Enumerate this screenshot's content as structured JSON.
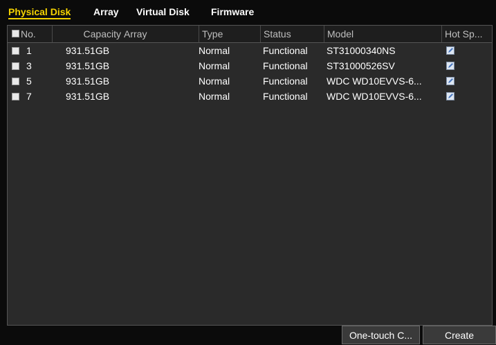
{
  "tabs": [
    {
      "label": "Physical Disk",
      "active": true
    },
    {
      "label": "Array",
      "active": false
    },
    {
      "label": "Virtual Disk",
      "active": false
    },
    {
      "label": "Firmware",
      "active": false
    }
  ],
  "table": {
    "columns": {
      "no": "No.",
      "capacity": "Capacity",
      "array": "Array",
      "type": "Type",
      "status": "Status",
      "model": "Model",
      "hot_spare": "Hot Sp..."
    },
    "rows": [
      {
        "no": "1",
        "capacity": "931.51GB",
        "array": "",
        "type": "Normal",
        "status": "Functional",
        "model": "ST31000340NS"
      },
      {
        "no": "3",
        "capacity": "931.51GB",
        "array": "",
        "type": "Normal",
        "status": "Functional",
        "model": "ST31000526SV"
      },
      {
        "no": "5",
        "capacity": "931.51GB",
        "array": "",
        "type": "Normal",
        "status": "Functional",
        "model": "WDC WD10EVVS-6..."
      },
      {
        "no": "7",
        "capacity": "931.51GB",
        "array": "",
        "type": "Normal",
        "status": "Functional",
        "model": "WDC WD10EVVS-6..."
      }
    ]
  },
  "buttons": {
    "one_touch": "One-touch C...",
    "create": "Create"
  },
  "colors": {
    "active_tab": "#f5d300",
    "panel_bg": "#2a2a2a",
    "page_bg": "#0b0b0b"
  },
  "icons": {
    "hot_spare_edit": "edit-icon"
  }
}
